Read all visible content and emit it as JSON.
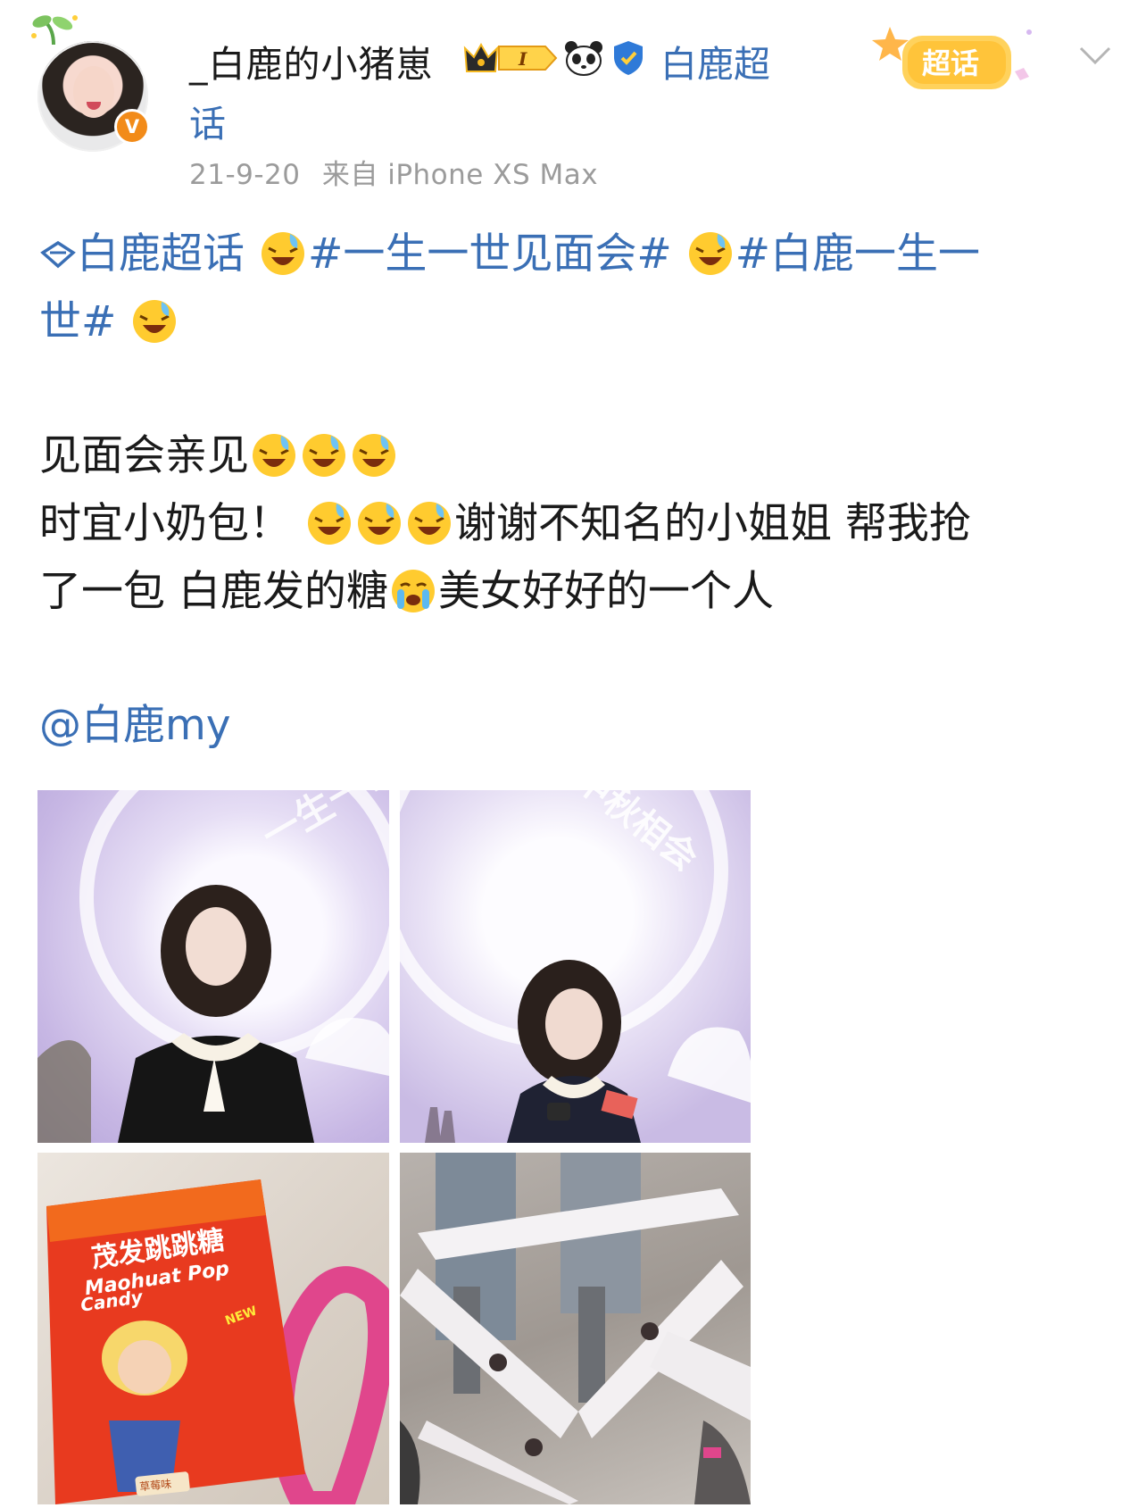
{
  "post": {
    "author": "_白鹿的小猪崽",
    "level_badge": "I",
    "topic_name_part1": "白鹿超",
    "topic_name_part2": "话",
    "date": "21-9-20",
    "source": "来自 iPhone XS Max",
    "badge_text": "超话",
    "verified_mark": "V"
  },
  "content": {
    "tag_topic": "白鹿超话",
    "tag_1": "#一生一世见面会#",
    "tag_2_part1": "#白鹿一生一",
    "tag_2_part2": "世#",
    "line_1": "见面会亲见",
    "line_2_part1": "时宜小奶包！",
    "line_2_part2": "谢谢不知名的小姐姐 帮我抢",
    "line_3_part1": "了一包 白鹿发的糖",
    "line_3_part2": "美女好好的一个人",
    "mention": "@白鹿my"
  },
  "photos": {
    "p1_text": "一生一世",
    "p2_text": "中秋相会",
    "p3_text1": "茂发跳跳糖",
    "p3_text2": "Maohuat Pop",
    "p3_text3": "Candy",
    "p3_text4": "草莓味",
    "p3_text5": "NEW"
  },
  "colors": {
    "link_blue": "#3a6fb5",
    "meta_gray": "#9b9b9b",
    "badge_orange": "#f28b19"
  },
  "icons": [
    "sprout-icon",
    "verified-icon",
    "crown-level-icon",
    "panda-icon",
    "shield-icon",
    "chaohua-badge-icon",
    "chevron-down-icon",
    "diamond-topic-icon",
    "laugh-cry-emoji",
    "crying-emoji"
  ]
}
